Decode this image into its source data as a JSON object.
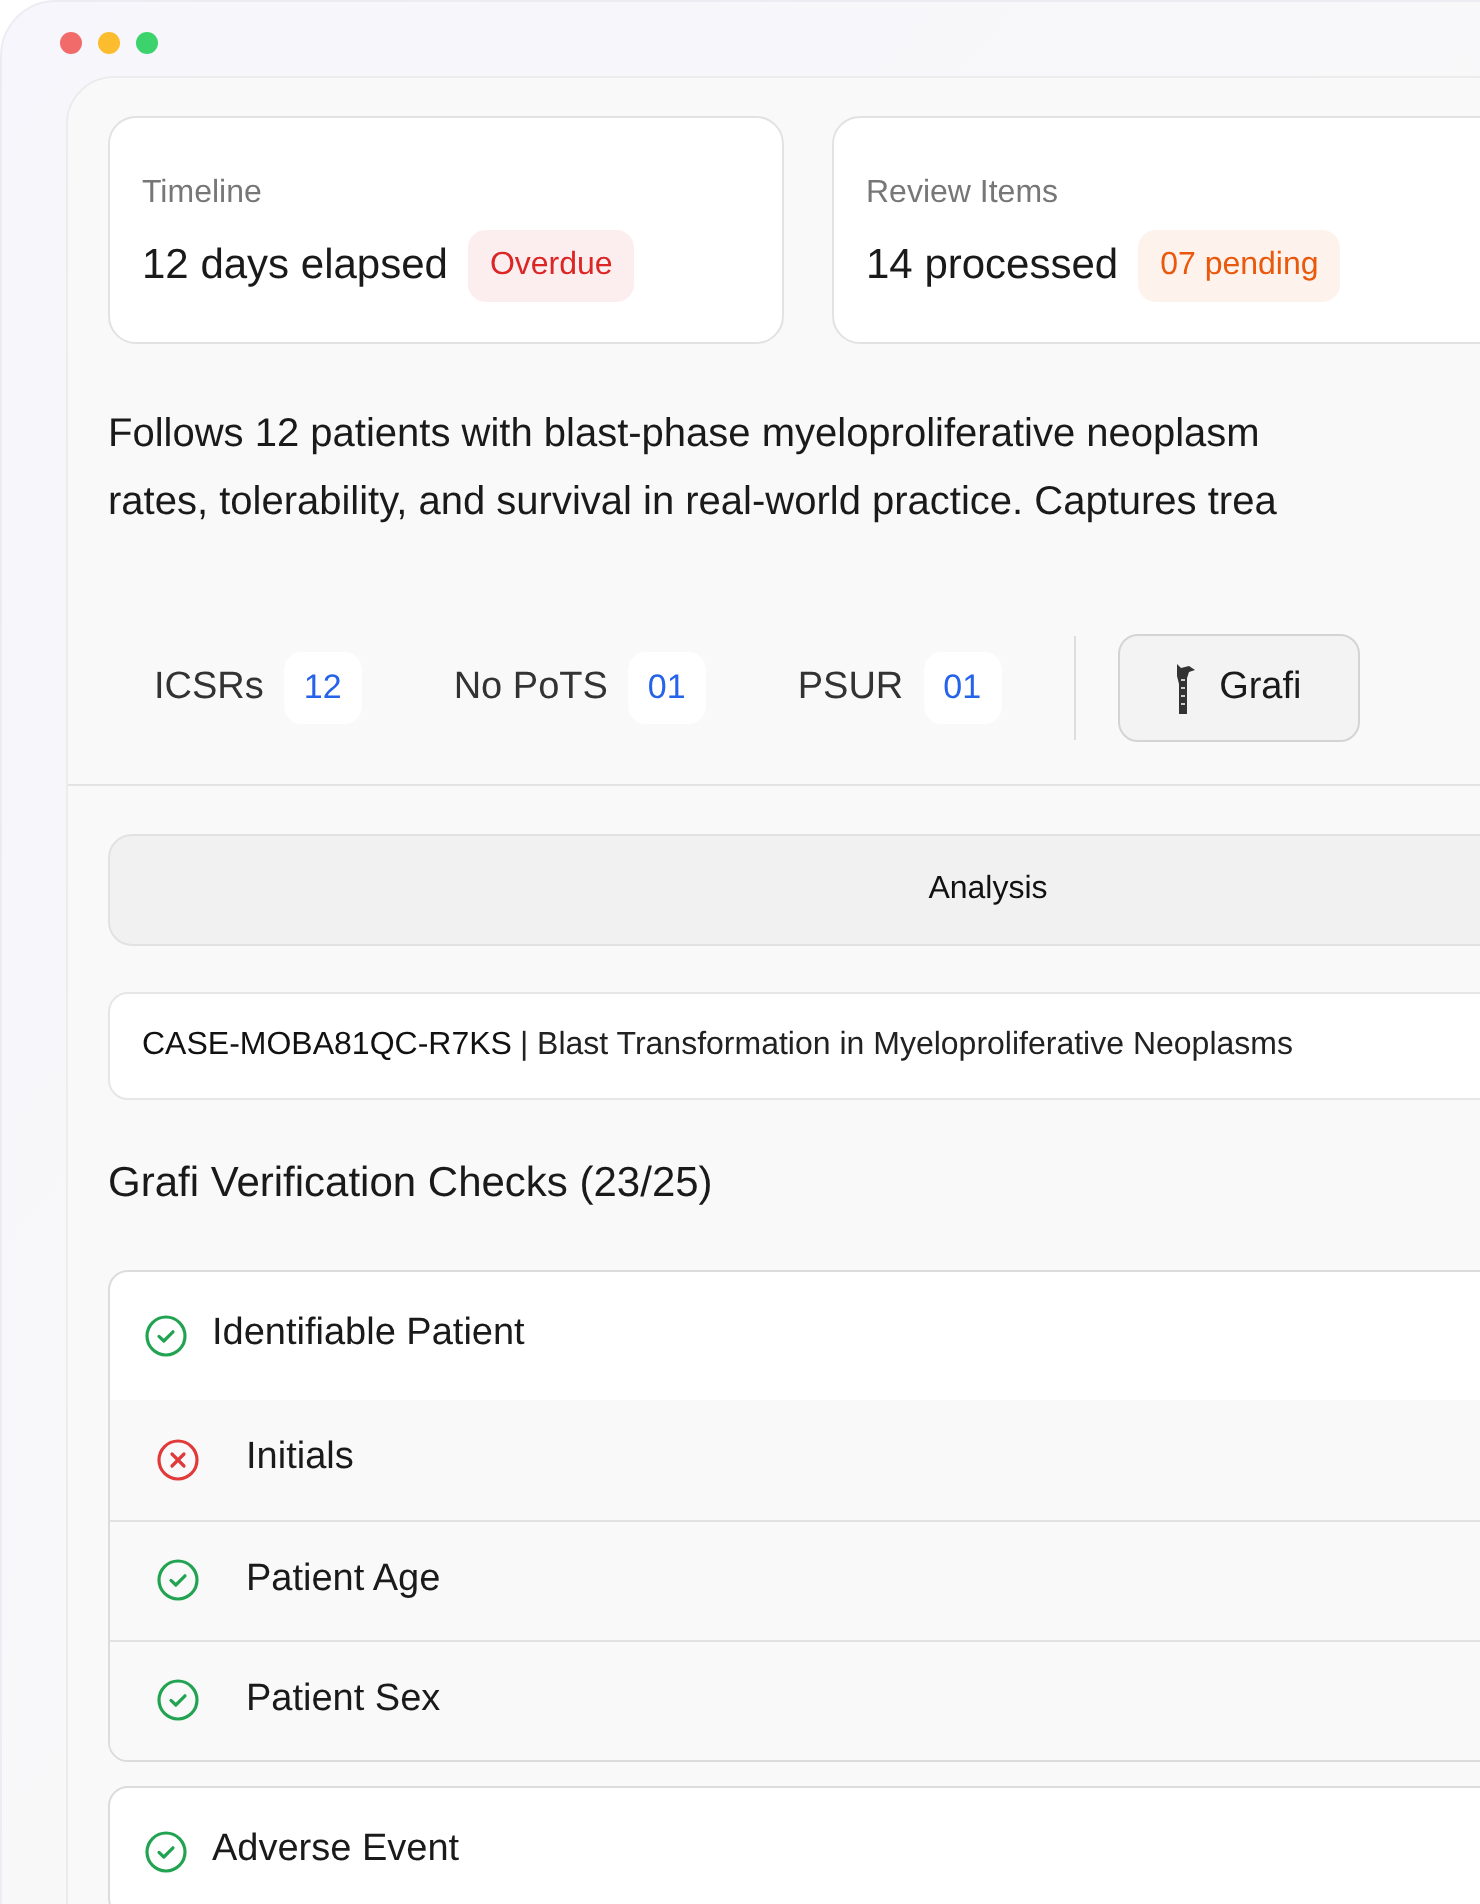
{
  "summary_cards": [
    {
      "label": "Timeline",
      "value": "12 days elapsed",
      "badge": "Overdue",
      "color": "#dc2626"
    },
    {
      "label": "Review Items",
      "value": "14 processed",
      "badge": "07 pending",
      "color": "#ea580c"
    }
  ],
  "description": [
    "Follows 12 patients with blast-phase myeloproliferative neoplasm",
    "rates, tolerability, and survival in real-world practice. Captures trea"
  ],
  "counters": [
    {
      "label": "ICSRs",
      "count": "12"
    },
    {
      "label": "No PoTS",
      "count": "01"
    },
    {
      "label": "PSUR",
      "count": "01"
    }
  ],
  "grafi_button": "Grafi",
  "tabs": [
    {
      "label": "Analysis",
      "selected": true
    }
  ],
  "case_field": {
    "id": "CASE-MOBA81QC-R7KS",
    "title": "| Blast Transformation in Myeloproliferative Neoplasms"
  },
  "checks_heading": "Grafi Verification Checks (23/25)",
  "check_groups": [
    {
      "title": "Identifiable Patient",
      "passed": true,
      "children": [
        {
          "title": "Initials",
          "passed": false
        },
        {
          "title": "Patient Age",
          "passed": true
        },
        {
          "title": "Patient Sex",
          "passed": true
        }
      ]
    },
    {
      "title": "Adverse Event",
      "passed": true
    }
  ]
}
